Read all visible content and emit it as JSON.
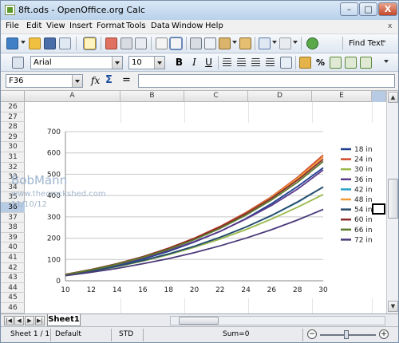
{
  "window": {
    "title": "8ft.ods - OpenOffice.org Calc",
    "min": "–",
    "max": "□",
    "close": "X"
  },
  "menu": {
    "items": [
      "File",
      "Edit",
      "View",
      "Insert",
      "Format",
      "Tools",
      "Data",
      "Window",
      "Help"
    ],
    "close_doc": "x"
  },
  "toolbar": {
    "find_text": "Find Text",
    "find_more": "»"
  },
  "format": {
    "font_name": "Arial",
    "font_size": "10",
    "bold": "B",
    "italic": "I",
    "underline": "U",
    "percent": "%"
  },
  "formula": {
    "cell_ref": "F36",
    "fx": "fx",
    "sum": "Σ",
    "equals": "=",
    "value": ""
  },
  "columns": [
    "A",
    "B",
    "C",
    "D",
    "E"
  ],
  "rows": [
    "26",
    "27",
    "28",
    "29",
    "30",
    "31",
    "32",
    "33",
    "34",
    "35",
    "36",
    "37",
    "38",
    "39",
    "40",
    "41",
    "42",
    "43",
    "44",
    "45",
    "46"
  ],
  "selected_row": "36",
  "sheet": {
    "tab": "Sheet1"
  },
  "status": {
    "page": "Sheet 1 / 1",
    "style": "Default",
    "mode": "STD",
    "sum": "Sum=0"
  },
  "watermark": {
    "name": "BobMann",
    "url": "www.thecrockshed.com",
    "date": "11/10/12"
  },
  "chart_data": {
    "type": "line",
    "x": [
      10,
      12,
      14,
      16,
      18,
      20,
      22,
      24,
      26,
      28,
      30
    ],
    "xlim": [
      10,
      30
    ],
    "ylim": [
      0,
      700
    ],
    "xticks": [
      "10",
      "12",
      "14",
      "16",
      "18",
      "20",
      "22",
      "24",
      "26",
      "28",
      "30"
    ],
    "yticks": [
      "0",
      "100",
      "200",
      "300",
      "400",
      "500",
      "600",
      "700"
    ],
    "legend_position": "right",
    "grid": "horizontal",
    "series": [
      {
        "name": "18 in",
        "color": "#1f3f8f",
        "values": [
          28,
          48,
          72,
          102,
          138,
          182,
          232,
          292,
          362,
          442,
          530
        ]
      },
      {
        "name": "24 in",
        "color": "#d04a2a",
        "values": [
          30,
          52,
          80,
          113,
          153,
          200,
          255,
          320,
          395,
          485,
          590
        ]
      },
      {
        "name": "30 in",
        "color": "#9ab84a",
        "values": [
          26,
          44,
          66,
          92,
          122,
          157,
          196,
          240,
          290,
          345,
          405
        ]
      },
      {
        "name": "36 in",
        "color": "#5a3a8a",
        "values": [
          28,
          50,
          76,
          106,
          142,
          184,
          232,
          290,
          354,
          430,
          520
        ]
      },
      {
        "name": "42 in",
        "color": "#2aa0c8",
        "values": [
          26,
          45,
          68,
          95,
          126,
          162,
          204,
          252,
          306,
          368,
          440
        ]
      },
      {
        "name": "48 in",
        "color": "#f09a3a",
        "values": [
          29,
          51,
          78,
          110,
          149,
          196,
          250,
          316,
          392,
          480,
          580
        ]
      },
      {
        "name": "54 in",
        "color": "#2a4a6a",
        "values": [
          27,
          46,
          68,
          95,
          126,
          162,
          204,
          252,
          307,
          370,
          440
        ]
      },
      {
        "name": "60 in",
        "color": "#8b2a2a",
        "values": [
          30,
          53,
          80,
          113,
          152,
          198,
          252,
          315,
          388,
          472,
          570
        ]
      },
      {
        "name": "66 in",
        "color": "#5a7a2a",
        "values": [
          29,
          51,
          78,
          110,
          148,
          193,
          246,
          308,
          380,
          462,
          560
        ]
      },
      {
        "name": "72 in",
        "color": "#4a3a7a",
        "values": [
          24,
          40,
          58,
          80,
          104,
          132,
          164,
          200,
          240,
          285,
          335
        ]
      }
    ]
  }
}
